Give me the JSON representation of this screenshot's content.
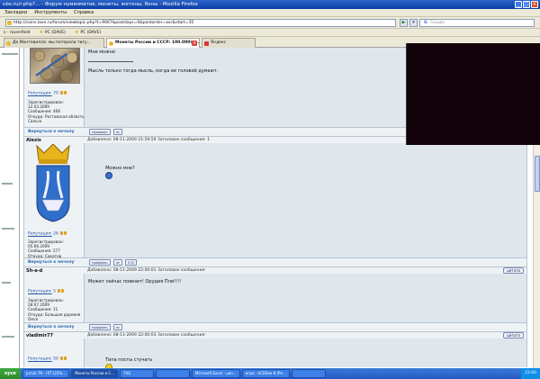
{
  "window": {
    "title": "ubs.ru/r.php?... - Форум нумизматов, монеты, жетоны, боны - Mozilla Firefox"
  },
  "menu": [
    "Закладки",
    "Инструменты",
    "Справка"
  ],
  "nav": {
    "url": "http://coins.lave.ru/forum/viewtopic.php?t=9067&postdays=0&postorder=asc&start=35",
    "search_engine": "Google",
    "search_placeholder": "Google"
  },
  "bookmarks": [
    {
      "label": "s - ravenfield",
      "icon": "star-icon"
    },
    {
      "label": "PC (DAVE)",
      "icon": "star-icon"
    },
    {
      "label": "PC (DAVE)",
      "icon": "star-icon"
    }
  ],
  "tabs": [
    {
      "label": "Де Монтевилла: мы потерели тигу...",
      "active": false
    },
    {
      "label": "Монеты России и СССР: 100.000тг...",
      "active": true
    },
    {
      "label": "Яндекс",
      "active": false
    }
  ],
  "posts": [
    {
      "author": "",
      "text": "Мне можно\n\n\nМысль только тогда мысль, когда ее головой думают.",
      "rep_label": "Репутация:",
      "rep_value": "70",
      "info": "Зарегистрирован:\n22.03.2009\nСообщения: 468\nОткуда: Ростовская область\nСальск",
      "back": "Вернуться к началу",
      "buttons": [
        "профиль",
        "лс"
      ]
    },
    {
      "author": "Alexis",
      "meta": "Добавлено: 08-11-2009 21:59:59    Заголовок сообщения: 1",
      "text": "Можно мне?",
      "rep_label": "Репутация:",
      "rep_value": "26",
      "info": "Зарегистрирован:\n05.06.2009\nСообщения: 277\nОткуда: Саратов",
      "back": "Вернуться к началу",
      "buttons": [
        "профиль",
        "лс",
        "ICQ"
      ]
    },
    {
      "author": "Sh-a-d",
      "meta": "Добавлено: 08-11-2009 22:00:01    Заголовок сообщения:",
      "quote": "цитата",
      "text": "Может сейчас повезет! Орудия Пли!!!!",
      "rep_label": "Репутация:",
      "rep_value": "5",
      "info": "Зарегистрирован:\n28.07.2009\nСообщения: 11\nОткуда: Большая деревня\nОмск",
      "back": "Вернуться к началу",
      "buttons": [
        "профиль",
        "лс"
      ]
    },
    {
      "author": "vladimir77",
      "meta": "Добавлено: 08-11-2009 22:00:03    Заголовок сообщения:",
      "quote": "цитата",
      "text": "Типа посты стучать",
      "rep_label": "Репутация:",
      "rep_value": "50"
    }
  ],
  "taskbar": {
    "start": "пуск",
    "tasks": [
      "Jurnal 7N - IXT (22%...",
      "Монеты России и С...",
      "7(6)",
      "",
      "Microsoft Excel - цен...",
      "игра - ACDSee 8 (Ре...",
      ""
    ],
    "clock": "22:00"
  },
  "colors": {
    "post_bg": "#dfe6ec",
    "header_bg": "#eef2f5",
    "link": "#2b6ab0",
    "titlebar": "#0a3fa8"
  }
}
